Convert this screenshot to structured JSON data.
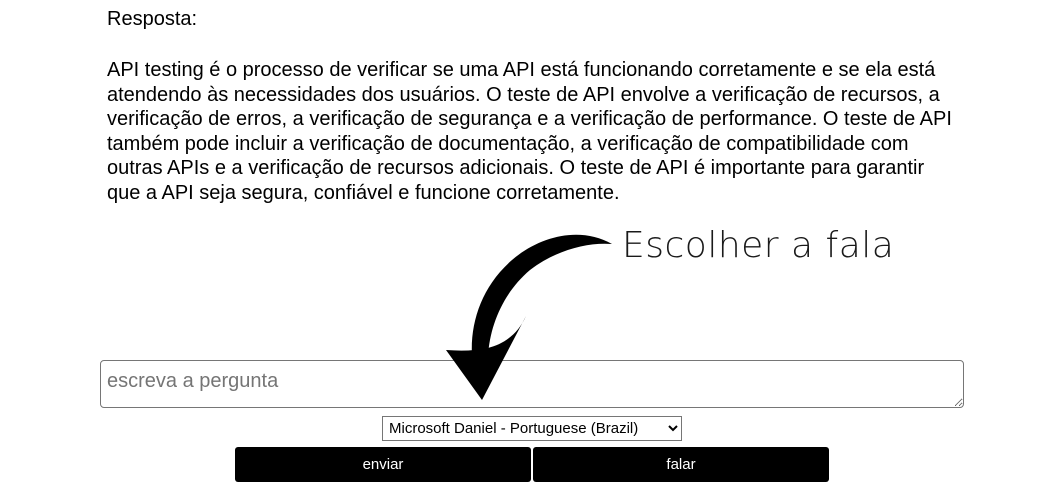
{
  "response": {
    "label": "Resposta:",
    "text": "API testing é o processo de verificar se uma API está funcionando corretamente e se ela está atendendo às necessidades dos usuários. O teste de API envolve a verificação de recursos, a verificação de erros, a verificação de segurança e a verificação de performance. O teste de API também pode incluir a verificação de documentação, a verificação de compatibilidade com outras APIs e a verificação de recursos adicionais. O teste de API é importante para garantir que a API seja segura, confiável e funcione corretamente."
  },
  "question": {
    "placeholder": "escreva a pergunta",
    "value": ""
  },
  "voice": {
    "selected": "Microsoft Daniel - Portuguese (Brazil)",
    "options": [
      "Microsoft Daniel - Portuguese (Brazil)"
    ]
  },
  "buttons": {
    "send_label": "enviar",
    "speak_label": "falar"
  },
  "annotation": {
    "label": "Escolher a fala",
    "color": "#000000"
  }
}
